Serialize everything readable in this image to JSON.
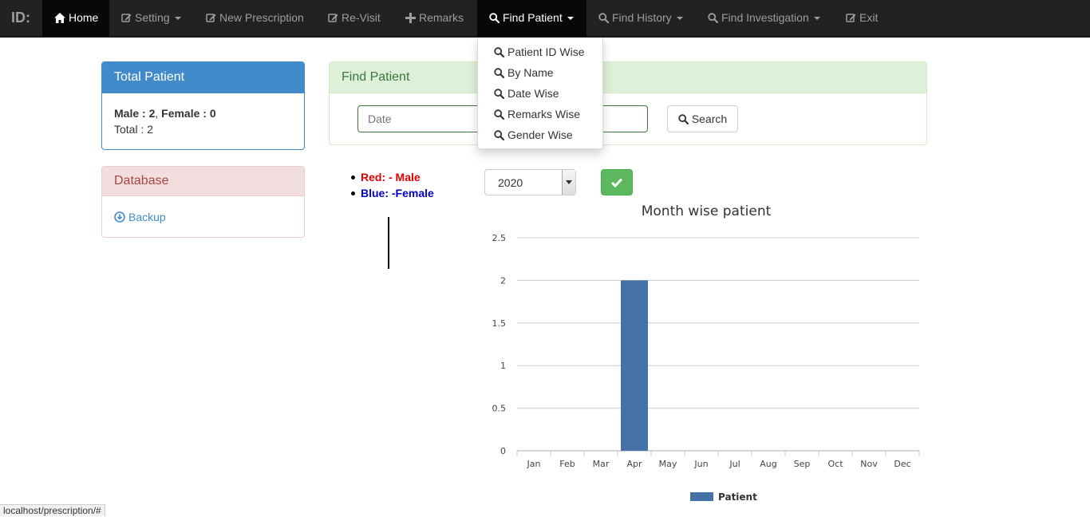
{
  "navbar": {
    "brand": "ID:",
    "items": [
      {
        "label": "Home"
      },
      {
        "label": "Setting"
      },
      {
        "label": "New Prescription"
      },
      {
        "label": "Re-Visit"
      },
      {
        "label": "Remarks"
      },
      {
        "label": "Find Patient"
      },
      {
        "label": "Find History"
      },
      {
        "label": "Find Investigation"
      },
      {
        "label": "Exit"
      }
    ]
  },
  "find_patient_menu": {
    "items": [
      "Patient ID Wise",
      "By Name",
      "Date Wise",
      "Remarks Wise",
      "Gender Wise"
    ]
  },
  "total_patient": {
    "title": "Total Patient",
    "male_label": "Male : 2",
    "separator": ",",
    "female_label": "Female : 0",
    "total_label": "Total : 2"
  },
  "database": {
    "title": "Database",
    "backup_label": "Backup"
  },
  "find_patient": {
    "title": "Find Patient",
    "date_placeholder": "Date",
    "search_label": "Search"
  },
  "gender_legend": {
    "male": "Red: - Male",
    "female": "Blue: -Female"
  },
  "year_select": {
    "selected": "2020"
  },
  "status_bar": {
    "url": "localhost/prescription/#"
  },
  "colors": {
    "bar": "#4472a6",
    "male": "#e00000",
    "female": "#0000cc",
    "navbar": "#222222",
    "primary": "#428bca",
    "success": "#5cb85c"
  },
  "chart_data": {
    "type": "bar",
    "title": "Month wise patient",
    "categories": [
      "Jan",
      "Feb",
      "Mar",
      "Apr",
      "May",
      "Jun",
      "Jul",
      "Aug",
      "Sep",
      "Oct",
      "Nov",
      "Dec"
    ],
    "series": [
      {
        "name": "Patient",
        "values": [
          0,
          0,
          0,
          2,
          0,
          0,
          0,
          0,
          0,
          0,
          0,
          0
        ]
      }
    ],
    "y_ticks": [
      "0",
      "0.5",
      "1",
      "1.5",
      "2",
      "2.5"
    ],
    "ylim": [
      0,
      2.5
    ],
    "grid": true,
    "legend": "bottom-center"
  }
}
